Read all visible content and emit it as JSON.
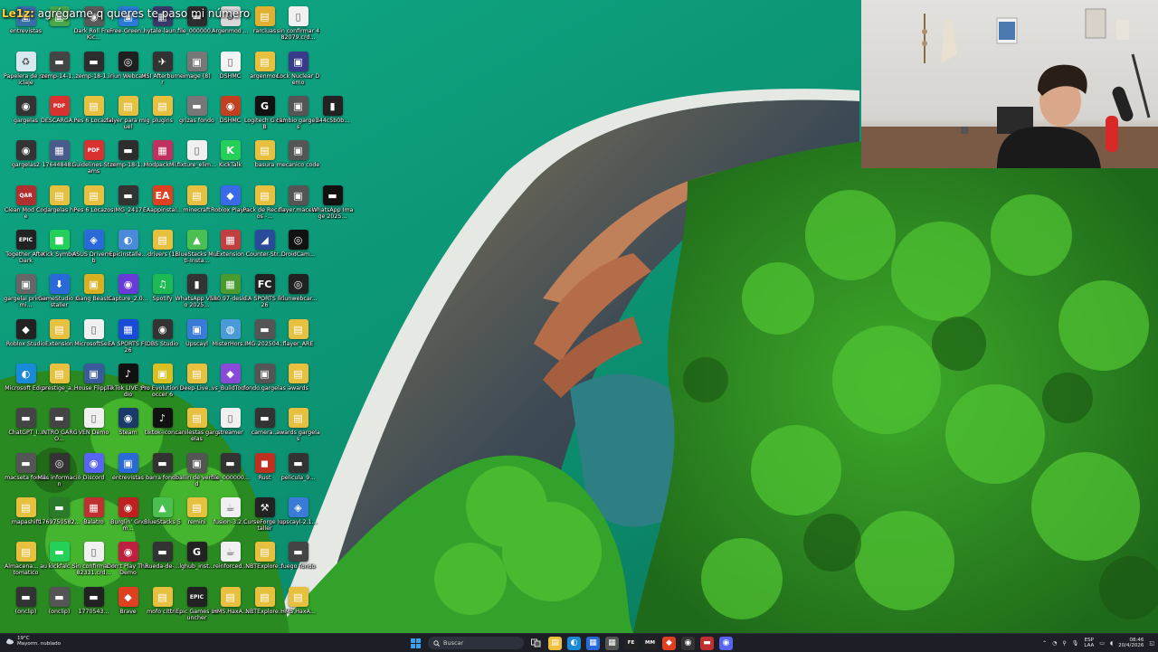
{
  "chat": {
    "user": "Le1z:",
    "message": "agrégame q queres te paso mi número"
  },
  "desktop_icons": [
    {
      "label": "entrevistas",
      "color": "#3a6ea8",
      "glyph": "▣"
    },
    {
      "label": "",
      "color": "#4aa84a",
      "glyph": "▣"
    },
    {
      "label": "Dark Roll Free Kic...",
      "color": "#5a5a5a",
      "glyph": "◉"
    },
    {
      "label": "Free-Green...",
      "color": "#2a7ad8",
      "glyph": "▣"
    },
    {
      "label": "hytale-laun...",
      "color": "#3a3a6a",
      "glyph": "▦"
    },
    {
      "label": "file_000000...",
      "color": "#2d2d2d",
      "glyph": "▬"
    },
    {
      "label": "Argenmod ...",
      "color": "#d8d8d8",
      "glyph": "⊛"
    },
    {
      "label": "rarcluas",
      "color": "#e0b030",
      "glyph": "▤"
    },
    {
      "label": "sin confirmar 482079.crd...",
      "color": "#f0f0f0",
      "glyph": "▯"
    },
    {
      "label": "Papelera de reciclaje",
      "color": "#d8e8f0",
      "glyph": "♻"
    },
    {
      "label": "zemp-14-1...",
      "color": "#444",
      "glyph": "▬"
    },
    {
      "label": "zemp-18-1...",
      "color": "#2d2d2d",
      "glyph": "▬"
    },
    {
      "label": "iriun Webcam",
      "color": "#1f1f1f",
      "glyph": "◎"
    },
    {
      "label": "MSI Afterburner",
      "color": "#333",
      "glyph": "✈"
    },
    {
      "label": "image (8)",
      "color": "#777",
      "glyph": "▣"
    },
    {
      "label": "DSHMC",
      "color": "#f4f4f4",
      "glyph": "▯"
    },
    {
      "label": "argenmod",
      "color": "#e8c040",
      "glyph": "▤"
    },
    {
      "label": "Lock Nuclear Demo",
      "color": "#3a3a8a",
      "glyph": "▣"
    },
    {
      "label": "gargelas",
      "color": "#333",
      "glyph": "◉"
    },
    {
      "label": "DESCARGA...",
      "color": "#d93030",
      "glyph": "PDF"
    },
    {
      "label": "Pes 6 Locazos",
      "color": "#e8c040",
      "glyph": "▤"
    },
    {
      "label": "falyer para miguel",
      "color": "#e8c040",
      "glyph": "▤"
    },
    {
      "label": "plugins",
      "color": "#e8c040",
      "glyph": "▤"
    },
    {
      "label": "grizas fondo",
      "color": "#777",
      "glyph": "▬"
    },
    {
      "label": "DSHMC",
      "color": "#c04020",
      "glyph": "◉"
    },
    {
      "label": "Logitech G HUB",
      "color": "#111",
      "glyph": "G"
    },
    {
      "label": "cambio gargelas",
      "color": "#555",
      "glyph": "▣"
    },
    {
      "label": "344c5b0b...",
      "color": "#222",
      "glyph": "▮"
    },
    {
      "label": "gargelas2",
      "color": "#333",
      "glyph": "◉"
    },
    {
      "label": "17644848...",
      "color": "#4a5a8a",
      "glyph": "▦"
    },
    {
      "label": "Guidelines-Streams",
      "color": "#d93030",
      "glyph": "PDF"
    },
    {
      "label": "zemp-18-1...",
      "color": "#2d2d2d",
      "glyph": "▬"
    },
    {
      "label": "ModpackMi...",
      "color": "#c03060",
      "glyph": "▦"
    },
    {
      "label": "fixture_elim...",
      "color": "#f0f0f0",
      "glyph": "▯"
    },
    {
      "label": "KickTalk",
      "color": "#25d05a",
      "glyph": "K"
    },
    {
      "label": "basura",
      "color": "#e8c040",
      "glyph": "▤"
    },
    {
      "label": "mecanico code",
      "color": "#555",
      "glyph": "▣"
    },
    {
      "label": "Clean Mod Code",
      "color": "#b03030",
      "glyph": "QAR"
    },
    {
      "label": "gargelas hi",
      "color": "#e8c040",
      "glyph": "▤"
    },
    {
      "label": "Pes 6 Locazos",
      "color": "#e8c040",
      "glyph": "▤"
    },
    {
      "label": "IMG_2417",
      "color": "#333",
      "glyph": "▬"
    },
    {
      "label": "EAappinstal...",
      "color": "#e04020",
      "glyph": "EA"
    },
    {
      "label": "minecraft",
      "color": "#e8c040",
      "glyph": "▤"
    },
    {
      "label": "Roblox Player",
      "color": "#3a6ae8",
      "glyph": "◆"
    },
    {
      "label": "Pack de Recursos -...",
      "color": "#e8c040",
      "glyph": "▤"
    },
    {
      "label": "flayer.maceta",
      "color": "#555",
      "glyph": "▣"
    },
    {
      "label": "WhatsApp Image 2025...",
      "color": "#111",
      "glyph": "▬"
    },
    {
      "label": "Together After Dark",
      "color": "#222",
      "glyph": "EPIC"
    },
    {
      "label": "Kick Symbol",
      "color": "#25d05a",
      "glyph": "■"
    },
    {
      "label": "ASUS DriverHub",
      "color": "#2a6ad8",
      "glyph": "◈"
    },
    {
      "label": "Epicinstalle...",
      "color": "#4a8ad8",
      "glyph": "◐"
    },
    {
      "label": "drivers (1)",
      "color": "#e8c040",
      "glyph": "▤"
    },
    {
      "label": "BlueStacks Multi-Insta...",
      "color": "#4ac050",
      "glyph": "▲"
    },
    {
      "label": "Extension",
      "color": "#c04040",
      "glyph": "▦"
    },
    {
      "label": "Counter-Str...",
      "color": "#2a4a9a",
      "glyph": "◢"
    },
    {
      "label": "DroidCam...",
      "color": "#111",
      "glyph": "◎"
    },
    {
      "label": "gargelai primer mi...",
      "color": "#666",
      "glyph": "▣"
    },
    {
      "label": "GameStudio Installer",
      "color": "#2a6ad8",
      "glyph": "⬇"
    },
    {
      "label": "Gang Beasts",
      "color": "#d8b020",
      "glyph": "▣"
    },
    {
      "label": "Capture_2.0...",
      "color": "#6a3ad8",
      "glyph": "◉"
    },
    {
      "label": "Spotify",
      "color": "#1db954",
      "glyph": "♫"
    },
    {
      "label": "WhatsApp Video 2025...",
      "color": "#333",
      "glyph": "▮"
    },
    {
      "label": "580.97-desk...",
      "color": "#4a9a30",
      "glyph": "▦"
    },
    {
      "label": "EA SPORTS FC 26",
      "color": "#222",
      "glyph": "FC"
    },
    {
      "label": "iriunwebcar...",
      "color": "#222",
      "glyph": "◎"
    },
    {
      "label": "Roblox Studio",
      "color": "#222",
      "glyph": "◆"
    },
    {
      "label": "Extension",
      "color": "#e8c040",
      "glyph": "▤"
    },
    {
      "label": "MicrosoftSe...",
      "color": "#f0f0f0",
      "glyph": "▯"
    },
    {
      "label": "EA SPORTS FC 26",
      "color": "#1a4ad8",
      "glyph": "▦"
    },
    {
      "label": "OBS Studio",
      "color": "#333",
      "glyph": "◉"
    },
    {
      "label": "Upscayl",
      "color": "#3a7ad8",
      "glyph": "▣"
    },
    {
      "label": "MisterHors...",
      "color": "#4a9ad8",
      "glyph": "◍"
    },
    {
      "label": "IMG-202504...",
      "color": "#555",
      "glyph": "▬"
    },
    {
      "label": "flayer_ARE",
      "color": "#e8c040",
      "glyph": "▤"
    },
    {
      "label": "Microsoft Edge",
      "color": "#1a8ad8",
      "glyph": "◐"
    },
    {
      "label": "prestige_a...",
      "color": "#e8c040",
      "glyph": "▤"
    },
    {
      "label": "House Flipper",
      "color": "#3a5a9a",
      "glyph": "▣"
    },
    {
      "label": "TikTok LIVE Studio",
      "color": "#111",
      "glyph": "♪"
    },
    {
      "label": "Pro Evolution Soccer 6",
      "color": "#d8c020",
      "glyph": "▣"
    },
    {
      "label": "Deep-Live...",
      "color": "#e8c040",
      "glyph": "▤"
    },
    {
      "label": "vs_BuildTools",
      "color": "#8a4ad8",
      "glyph": "◆"
    },
    {
      "label": "fondo.gargelas",
      "color": "#555",
      "glyph": "▣"
    },
    {
      "label": "awards",
      "color": "#e8c040",
      "glyph": "▤"
    },
    {
      "label": "ChatGPT_I...",
      "color": "#444",
      "glyph": "▬"
    },
    {
      "label": "INTRO GARGO...",
      "color": "#444",
      "glyph": "▬"
    },
    {
      "label": "VEN Demo",
      "color": "#f0f0f0",
      "glyph": "▯"
    },
    {
      "label": "Steam",
      "color": "#1a3a6a",
      "glyph": "◉"
    },
    {
      "label": "tiktok-icon...",
      "color": "#111",
      "glyph": "♪"
    },
    {
      "label": "canilestas gargelas",
      "color": "#e8c040",
      "glyph": "▤"
    },
    {
      "label": "streamer",
      "color": "#f0f0f0",
      "glyph": "▯"
    },
    {
      "label": "camera...",
      "color": "#333",
      "glyph": "▬"
    },
    {
      "label": "awards gargelas",
      "color": "#e8c040",
      "glyph": "▤"
    },
    {
      "label": "macseta fondo",
      "color": "#555",
      "glyph": "▬"
    },
    {
      "label": "Más información",
      "color": "#333",
      "glyph": "◎"
    },
    {
      "label": "Discord",
      "color": "#5865f2",
      "glyph": "◉"
    },
    {
      "label": "entrevistas",
      "color": "#2a6ad8",
      "glyph": "▣"
    },
    {
      "label": "barra fondo",
      "color": "#333",
      "glyph": "▬"
    },
    {
      "label": "ballin de verdad",
      "color": "#555",
      "glyph": "▣"
    },
    {
      "label": "file_000000...",
      "color": "#333",
      "glyph": "▬"
    },
    {
      "label": "Rust",
      "color": "#c03020",
      "glyph": "◼"
    },
    {
      "label": "pelicula_9...",
      "color": "#333",
      "glyph": "▬"
    },
    {
      "label": "mapashift",
      "color": "#e8c040",
      "glyph": "▤"
    },
    {
      "label": "1769750582...",
      "color": "#2a7a2a",
      "glyph": "▬"
    },
    {
      "label": "Balatro",
      "color": "#c03030",
      "glyph": "▦"
    },
    {
      "label": "Burglin' Gnom...",
      "color": "#c02020",
      "glyph": "◉"
    },
    {
      "label": "BlueStacks 5",
      "color": "#4ac050",
      "glyph": "▲"
    },
    {
      "label": "remini",
      "color": "#e8c040",
      "glyph": "▤"
    },
    {
      "label": "fusion-3.2...",
      "color": "#f0f0f0",
      "glyph": "☕"
    },
    {
      "label": "CurseForge Installer",
      "color": "#222",
      "glyph": "⚒"
    },
    {
      "label": "upscayl-2.1...",
      "color": "#3a7ad8",
      "glyph": "◈"
    },
    {
      "label": "Almacena... automatico",
      "color": "#e8c040",
      "glyph": "▤"
    },
    {
      "label": "kickfalc",
      "color": "#25d05a",
      "glyph": "▬"
    },
    {
      "label": "Sin confirmar 482331.crd...",
      "color": "#f0f0f0",
      "glyph": "▯"
    },
    {
      "label": "Don't Play This Demo",
      "color": "#c02040",
      "glyph": "◉"
    },
    {
      "label": "Rueda-de-...",
      "color": "#333",
      "glyph": "▬"
    },
    {
      "label": "lghub_inst...",
      "color": "#222",
      "glyph": "G"
    },
    {
      "label": "reinforced...",
      "color": "#f0f0f0",
      "glyph": "☕"
    },
    {
      "label": "NBTExplore...",
      "color": "#e8c040",
      "glyph": "▤"
    },
    {
      "label": "fuego fondo",
      "color": "#444",
      "glyph": "▬"
    },
    {
      "label": "(onclip)",
      "color": "#333",
      "glyph": "▬"
    },
    {
      "label": "(onclip)",
      "color": "#555",
      "glyph": "▬"
    },
    {
      "label": "1770543...",
      "color": "#222",
      "glyph": "▬"
    },
    {
      "label": "Brave",
      "color": "#e04020",
      "glyph": "◆"
    },
    {
      "label": "mofo cittrit",
      "color": "#e8c040",
      "glyph": "▤"
    },
    {
      "label": "Epic Games Launcher",
      "color": "#222",
      "glyph": "EPIC"
    },
    {
      "label": "HMS.HaxA...",
      "color": "#e8c040",
      "glyph": "▤"
    },
    {
      "label": "NBTExplore...",
      "color": "#e8c040",
      "glyph": "▤"
    },
    {
      "label": "HMS.HaxA...",
      "color": "#e8c040",
      "glyph": "▤"
    },
    {
      "label": "Free Fire MAX",
      "color": "#3a4a8a",
      "glyph": "▣"
    },
    {
      "label": "LetsView",
      "color": "#3a9ad8",
      "glyph": "◈"
    },
    {
      "label": "Sin confirmar 338672.crd...",
      "color": "#f0f0f0",
      "glyph": "▯"
    }
  ],
  "taskbar": {
    "weather_temp": "19°C",
    "weather_desc": "Mayorm. nublado",
    "search_placeholder": "Buscar",
    "tray_lang": "ESP",
    "tray_lang_sub": "LAA",
    "time": "08:46",
    "date": "20/4/2026",
    "apps": [
      {
        "name": "file-explorer",
        "color": "#f0c040",
        "glyph": "▤"
      },
      {
        "name": "edge",
        "color": "#1a8ad8",
        "glyph": "◐"
      },
      {
        "name": "store",
        "color": "#2a6ad8",
        "glyph": "▦"
      },
      {
        "name": "calculator",
        "color": "#555",
        "glyph": "▦"
      },
      {
        "name": "fc",
        "color": "#222",
        "glyph": "FE"
      },
      {
        "name": "mm",
        "color": "#222",
        "glyph": "MM"
      },
      {
        "name": "brave",
        "color": "#e04020",
        "glyph": "◆"
      },
      {
        "name": "obs",
        "color": "#333",
        "glyph": "◉"
      },
      {
        "name": "media",
        "color": "#c03030",
        "glyph": "▬"
      },
      {
        "name": "discord",
        "color": "#5865f2",
        "glyph": "◉"
      }
    ]
  }
}
